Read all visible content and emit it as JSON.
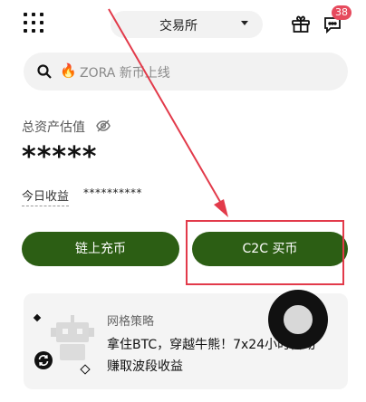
{
  "header": {
    "exchange_label": "交易所",
    "message_badge": "38"
  },
  "search": {
    "placeholder": "ZORA 新币上线"
  },
  "assets": {
    "label": "总资产估值",
    "value": "*****",
    "today_label": "今日收益",
    "today_value": "**********"
  },
  "buttons": {
    "deposit": "链上充币",
    "c2c": "C2C 买币"
  },
  "card": {
    "title": "网格策略",
    "line1": "拿住BTC，穿越牛熊！7x24小时自动",
    "line2": "赚取波段收益"
  },
  "colors": {
    "primary_green": "#2c5e14",
    "badge_red": "#e64a5d",
    "annotation_red": "#e23a4a"
  },
  "icons": [
    "apps-grid-icon",
    "gift-icon",
    "message-icon",
    "search-icon",
    "fire-icon",
    "eye-off-icon",
    "robot-icon",
    "sync-icon"
  ]
}
